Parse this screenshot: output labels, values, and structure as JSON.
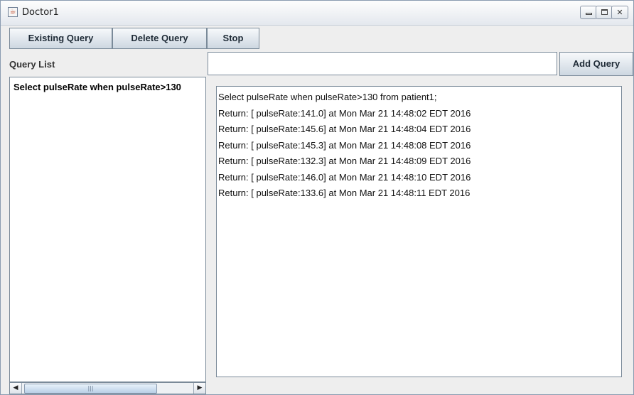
{
  "window": {
    "title": "Doctor1",
    "icon": "java-cup-icon"
  },
  "toolbar": {
    "existing_query_label": "Existing Query",
    "delete_query_label": "Delete Query",
    "stop_label": "Stop"
  },
  "query_list": {
    "label": "Query List",
    "items": [
      "Select pulseRate when pulseRate>130"
    ]
  },
  "query_input": {
    "value": "",
    "placeholder": ""
  },
  "add_query_label": "Add Query",
  "output": {
    "lines": [
      "Select pulseRate when pulseRate>130 from patient1;",
      "Return: [ pulseRate:141.0] at Mon Mar 21 14:48:02 EDT 2016",
      "Return: [ pulseRate:145.6] at Mon Mar 21 14:48:04 EDT 2016",
      "Return: [ pulseRate:145.3] at Mon Mar 21 14:48:08 EDT 2016",
      "Return: [ pulseRate:132.3] at Mon Mar 21 14:48:09 EDT 2016",
      "Return: [ pulseRate:146.0] at Mon Mar 21 14:48:10 EDT 2016",
      "Return: [ pulseRate:133.6] at Mon Mar 21 14:48:11 EDT 2016"
    ]
  },
  "scrollbar": {
    "left_arrow": "◀",
    "right_arrow": "▶",
    "thumb_grip": "|||"
  },
  "window_controls": {
    "close_glyph": "✕"
  }
}
